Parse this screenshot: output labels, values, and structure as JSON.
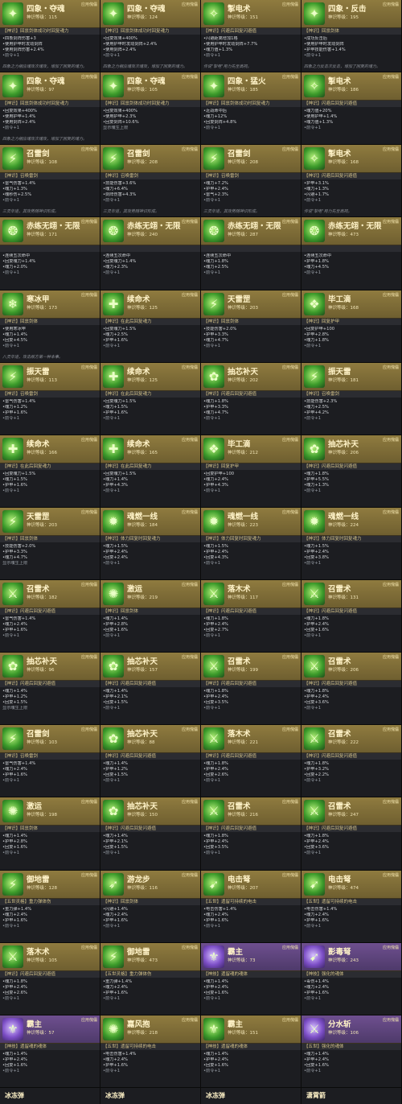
{
  "cards": [
    {
      "name": "四象・夺魂",
      "sub": "神识等级：115",
      "tag": "应用傀儡",
      "type": "【神识】回禀剑体成功时回复魂力",
      "lines": [
        "•四象剑阵伤害+3",
        "•使用护甲时发动剑阵",
        "•使用剑阵伤害+2.4%"
      ],
      "more": "•前令+1",
      "lore": "四象之力相应魂攻次魂攻，增加了回复的魂力。",
      "color": "gold",
      "icon": "✦"
    },
    {
      "name": "四象・夺魂",
      "sub": "神识等级：124",
      "tag": "应用傀儡",
      "type": "【神识】回禀剑体成功时回复魂力",
      "lines": [
        "•回复效果+400%",
        "•使用护甲时发动剑阵+2.4%",
        "•使用剑阵+2.4%"
      ],
      "more": "•前令+1",
      "lore": "四象之力相应魂攻次魂攻，增加了回复的魂力。",
      "color": "gold",
      "icon": "✦"
    },
    {
      "name": "掣电术",
      "sub": "神识等级：151",
      "tag": "应用傀儡",
      "type": "【神识】闪避后回复闪避值",
      "lines": [
        "•闪避距离增加1格",
        "•使用护甲时发动剑阵+7.7%",
        "•魂力值+1.3%"
      ],
      "more": "•前令+1",
      "lore": "传说\"掣电\"用力先至高视。",
      "color": "gold",
      "icon": "✧"
    },
    {
      "name": "四象・反击",
      "sub": "神识等级：195",
      "tag": "应用傀儡",
      "type": "【神识】回禀剑体",
      "lines": [
        "•成功反击后",
        "•使用护甲时发动剑阵",
        "•护甲技能伤害+1.4%"
      ],
      "more": "•前令+1",
      "lore": "四象之力反击次反击，增加了回复的魂力。",
      "color": "gold",
      "icon": "✦"
    },
    {
      "name": "四象・夺魂",
      "sub": "神识等级：97",
      "tag": "应用傀儡",
      "type": "【神识】回禀剑体成功时回复魂力",
      "lines": [
        "•回复效果+400%",
        "•使用护甲+1.4%",
        "•使用剑阵+2.4%"
      ],
      "more": "•前令+1",
      "lore": "四象之力相应魂攻次魂攻，增加了回复的魂力。",
      "color": "gold",
      "icon": "✦"
    },
    {
      "name": "四象・夺魂",
      "sub": "神识等级：105",
      "tag": "应用傀儡",
      "type": "【神识】回禀剑体成功时回复魂力",
      "lines": [
        "•回复效果+400%",
        "•使用护甲+2.3%",
        "•回复剑阵+10.6%"
      ],
      "more": "显示魂生上限",
      "lore": "",
      "color": "gold",
      "icon": "✦"
    },
    {
      "name": "四象・猛火",
      "sub": "神识等级：185",
      "tag": "应用傀儡",
      "type": "【神识】回禀剑体成功时回复魂力",
      "lines": [
        "•近战命中后",
        "•魂力+12%",
        "•回复剑阵+4.8%"
      ],
      "more": "•前令+1",
      "lore": "",
      "color": "gold",
      "icon": "✦"
    },
    {
      "name": "掣电术",
      "sub": "神识等级：186",
      "tag": "应用傀儡",
      "type": "【神识】闪避后回复闪避值",
      "lines": [
        "•魂力值+20%",
        "•使用护甲+1.4%",
        "•魂力值+1.3%"
      ],
      "more": "•前令+1",
      "lore": "",
      "color": "gold",
      "icon": "✧"
    },
    {
      "name": "召雷剑",
      "sub": "神识等级：108",
      "tag": "应用傀儡",
      "type": "【神识】召唤雷剑",
      "lines": [
        "•雷气伤害+1.4%",
        "•魂力+1.3%",
        "•魂秒伤+2.5%"
      ],
      "more": "•前令+1",
      "lore": "三灵华道，其攻势随神识形成。",
      "color": "gold",
      "icon": "⚡"
    },
    {
      "name": "召雷剑",
      "sub": "神识等级：208",
      "tag": "应用傀儡",
      "type": "【神识】召唤雷剑",
      "lines": [
        "•技能伤害+3.6%",
        "•魂力+6.4%",
        "•剑阵伤害+4.3%"
      ],
      "more": "•前令+1",
      "lore": "三灵华道，其攻势随神识形成。",
      "color": "gold",
      "icon": "⚡"
    },
    {
      "name": "召雷剑",
      "sub": "神识等级：208",
      "tag": "应用傀儡",
      "type": "【神识】召唤雷剑",
      "lines": [
        "•魂力+7.2%",
        "•护甲+2.4%",
        "•雷气+2.3%"
      ],
      "more": "•前令+1",
      "lore": "三灵华道，其攻势随神识形成。",
      "color": "gold",
      "icon": "⚡"
    },
    {
      "name": "掣电术",
      "sub": "神识等级：168",
      "tag": "应用傀儡",
      "type": "【神识】闪避后回复闪避值",
      "lines": [
        "•护甲+3.1%",
        "•魂力+1.3%",
        "•闪避+1.7%"
      ],
      "more": "•前令+1",
      "lore": "传说\"掣电\"用力先至高视。",
      "color": "gold",
      "icon": "✧"
    },
    {
      "name": "赤练无翊・无限",
      "sub": "神识等级：171",
      "tag": "应用傀儡",
      "type": "",
      "lines": [
        "•连续五次命中",
        "•回复魂力+1.4%",
        "•魂力+2.0%"
      ],
      "more": "•前令+1",
      "lore": "",
      "color": "gold",
      "icon": "❂"
    },
    {
      "name": "赤练无翊・无限",
      "sub": "神识等级：240",
      "tag": "应用傀儡",
      "type": "",
      "lines": [
        "•连续五次命中",
        "•回复魂力+1.4%",
        "•魂力+2.3%"
      ],
      "more": "•前令+1",
      "lore": "",
      "color": "gold",
      "icon": "❂"
    },
    {
      "name": "赤练无翊・无限",
      "sub": "神识等级：287",
      "tag": "应用傀儡",
      "type": "",
      "lines": [
        "•连续五次命中",
        "•魂力+1.8%",
        "•魂力+2.5%"
      ],
      "more": "•前令+1",
      "lore": "",
      "color": "gold",
      "icon": "❂"
    },
    {
      "name": "赤练无翊・无限",
      "sub": "神识等级：473",
      "tag": "应用傀儡",
      "type": "",
      "lines": [
        "•连续五次命中",
        "•护甲+1.8%",
        "•魂力+4.5%"
      ],
      "more": "•前令+1",
      "lore": "",
      "color": "gold",
      "icon": "❂"
    },
    {
      "name": "寒冰甲",
      "sub": "神识等级：173",
      "tag": "应用傀儡",
      "type": "【神识】回禀剑体",
      "lines": [
        "•使用寒冰甲",
        "•魂力+1.4%",
        "•回复+4.5%"
      ],
      "more": "•前令+1",
      "lore": "八灵华道，攻击敌方第一种本事。",
      "color": "gold",
      "icon": "❄"
    },
    {
      "name": "续命术",
      "sub": "神识等级：125",
      "tag": "应用傀儡",
      "type": "【神识】在此后回复魂力",
      "lines": [
        "•回复魂力+1.5%",
        "•魂力+2.5%",
        "•护甲+1.6%"
      ],
      "more": "•前令+1",
      "lore": "",
      "color": "gold",
      "icon": "✚"
    },
    {
      "name": "天雷罡",
      "sub": "神识等级：203",
      "tag": "应用傀儡",
      "type": "【神识】回禀剑体",
      "lines": [
        "•技能伤害+2.0%",
        "•护甲+3.3%",
        "•魂力+4.7%"
      ],
      "more": "•前令+1",
      "lore": "",
      "color": "gold",
      "icon": "⚡"
    },
    {
      "name": "毕工滴",
      "sub": "神识等级：168",
      "tag": "应用傀儡",
      "type": "【神识】回复护甲",
      "lines": [
        "•回复护甲+100",
        "•护甲+2.8%",
        "•魂力+1.8%"
      ],
      "more": "•前令+1",
      "lore": "",
      "color": "gold",
      "icon": "❖"
    },
    {
      "name": "振天雷",
      "sub": "神识等级：113",
      "tag": "应用傀儡",
      "type": "【神识】召唤雷剑",
      "lines": [
        "•雷气伤害+1.4%",
        "•魂力+1.2%",
        "•护甲+1.6%"
      ],
      "more": "•前令+1",
      "lore": "",
      "color": "gold",
      "icon": "⚡"
    },
    {
      "name": "续命术",
      "sub": "神识等级：125",
      "tag": "应用傀儡",
      "type": "【神识】在此后回复魂力",
      "lines": [
        "•回复魂力+1.5%",
        "•魂力+1.5%",
        "•护甲+1.6%"
      ],
      "more": "•前令+1",
      "lore": "",
      "color": "gold",
      "icon": "✚"
    },
    {
      "name": "抽芯补天",
      "sub": "神识等级：202",
      "tag": "应用傀儡",
      "type": "【神识】闪避后回复闪避值",
      "lines": [
        "•魂力+1.8%",
        "•护甲+3.3%",
        "•魂力+4.7%"
      ],
      "more": "•前令+1",
      "lore": "",
      "color": "gold",
      "icon": "✿"
    },
    {
      "name": "振天雷",
      "sub": "神识等级：181",
      "tag": "应用傀儡",
      "type": "【神识】召唤雷剑",
      "lines": [
        "•技能伤害+2.3%",
        "•魂力+2.5%",
        "•护甲+4.2%"
      ],
      "more": "•前令+1",
      "lore": "",
      "color": "gold",
      "icon": "⚡"
    },
    {
      "name": "续命术",
      "sub": "神识等级：166",
      "tag": "应用傀儡",
      "type": "【神识】在此后回复魂力",
      "lines": [
        "•回复魂力+1.5%",
        "•魂力+1.5%",
        "•护甲+1.6%"
      ],
      "more": "•前令+1",
      "lore": "",
      "color": "gold",
      "icon": "✚"
    },
    {
      "name": "续命术",
      "sub": "神识等级：165",
      "tag": "应用傀儡",
      "type": "【神识】在此后回复魂力",
      "lines": [
        "•回复魂力+1.5%",
        "•魂力+1.4%",
        "•护甲+4.3%"
      ],
      "more": "•前令+1",
      "lore": "",
      "color": "gold",
      "icon": "✚"
    },
    {
      "name": "毕工滴",
      "sub": "神识等级：212",
      "tag": "应用傀儡",
      "type": "【神识】回复护甲",
      "lines": [
        "•回复护甲+100",
        "•魂力+2.4%",
        "•护甲+4.3%"
      ],
      "more": "•前令+1",
      "lore": "",
      "color": "gold",
      "icon": "❖"
    },
    {
      "name": "抽芯补天",
      "sub": "神识等级：206",
      "tag": "应用傀儡",
      "type": "【神识】闪避后回复闪避值",
      "lines": [
        "•魂力+1.8%",
        "•护甲+5.5%",
        "•魂力+1.3%"
      ],
      "more": "•前令+1",
      "lore": "",
      "color": "gold",
      "icon": "✿"
    },
    {
      "name": "天雷罡",
      "sub": "神识等级：203",
      "tag": "应用傀儡",
      "type": "【神识】回禀剑体",
      "lines": [
        "•技能伤害+2.0%",
        "•护甲+3.3%",
        "•魂力+4.7%"
      ],
      "more": "显示魂生上限",
      "lore": "",
      "color": "gold",
      "icon": "⚡"
    },
    {
      "name": "魂燃一线",
      "sub": "神识等级：184",
      "tag": "应用傀儡",
      "type": "【神识】体力回复时回复魂力",
      "lines": [
        "•魂力+1.5%",
        "•护甲+2.4%",
        "•回复+2.4%"
      ],
      "more": "•前令+1",
      "lore": "",
      "color": "gold",
      "icon": "✹"
    },
    {
      "name": "魂燃一线",
      "sub": "神识等级：223",
      "tag": "应用傀儡",
      "type": "【神识】体力回复时回复魂力",
      "lines": [
        "•魂力+1.5%",
        "•护甲+2.4%",
        "•回复+4.3%"
      ],
      "more": "•前令+1",
      "lore": "",
      "color": "gold",
      "icon": "✹"
    },
    {
      "name": "魂燃一线",
      "sub": "神识等级：224",
      "tag": "应用傀儡",
      "type": "【神识】体力回复时回复魂力",
      "lines": [
        "•魂力+1.5%",
        "•护甲+2.4%",
        "•回复+3.8%"
      ],
      "more": "•前令+1",
      "lore": "",
      "color": "gold",
      "icon": "✹"
    },
    {
      "name": "召雷术",
      "sub": "神识等级：182",
      "tag": "应用傀儡",
      "type": "【神识】闪避后回复闪避值",
      "lines": [
        "•雷气伤害+1.4%",
        "•魂力+2.4%",
        "•护甲+1.6%"
      ],
      "more": "•前令+1",
      "lore": "",
      "color": "gold",
      "icon": "⚔"
    },
    {
      "name": "激运",
      "sub": "神识等级：219",
      "tag": "应用傀儡",
      "type": "【神识】回禀剑体",
      "lines": [
        "•魂力+1.4%",
        "•护甲+2.8%",
        "•回复+1.6%"
      ],
      "more": "•前令+1",
      "lore": "",
      "color": "gold",
      "icon": "✺"
    },
    {
      "name": "落木术",
      "sub": "神识等级：117",
      "tag": "应用傀儡",
      "type": "【神识】闪避后回复闪避值",
      "lines": [
        "•魂力+1.8%",
        "•护甲+2.4%",
        "•回复+2.7%"
      ],
      "more": "•前令+1",
      "lore": "",
      "color": "gold",
      "icon": "⚔"
    },
    {
      "name": "召雷术",
      "sub": "神识等级：131",
      "tag": "应用傀儡",
      "type": "【神识】闪避后回复闪避值",
      "lines": [
        "•魂力+1.8%",
        "•护甲+2.4%",
        "•回复+1.6%"
      ],
      "more": "•前令+1",
      "lore": "",
      "color": "gold",
      "icon": "⚔"
    },
    {
      "name": "抽芯补天",
      "sub": "神识等级：96",
      "tag": "应用傀儡",
      "type": "【神识】闪避后回复闪避值",
      "lines": [
        "•魂力+1.4%",
        "•护甲+1.2%",
        "•回复+1.5%"
      ],
      "more": "显示魂生上限",
      "lore": "",
      "color": "gold",
      "icon": "✿"
    },
    {
      "name": "抽芯补天",
      "sub": "神识等级：157",
      "tag": "应用傀儡",
      "type": "【神识】闪避后回复闪避值",
      "lines": [
        "•魂力+1.4%",
        "•护甲+2.1%",
        "•回复+1.5%"
      ],
      "more": "•前令+1",
      "lore": "",
      "color": "gold",
      "icon": "✿"
    },
    {
      "name": "召雷术",
      "sub": "神识等级：199",
      "tag": "应用傀儡",
      "type": "【神识】闪避后回复闪避值",
      "lines": [
        "•魂力+1.8%",
        "•护甲+2.4%",
        "•回复+3.5%"
      ],
      "more": "•前令+1",
      "lore": "",
      "color": "gold",
      "icon": "⚔"
    },
    {
      "name": "召雷术",
      "sub": "神识等级：206",
      "tag": "应用傀儡",
      "type": "【神识】闪避后回复闪避值",
      "lines": [
        "•魂力+1.8%",
        "•护甲+2.4%",
        "•回复+3.6%"
      ],
      "more": "•前令+1",
      "lore": "",
      "color": "gold",
      "icon": "⚔"
    },
    {
      "name": "召雷剑",
      "sub": "神识等级：103",
      "tag": "应用傀儡",
      "type": "【神识】召唤雷剑",
      "lines": [
        "•雷气伤害+1.4%",
        "•魂力+2.4%",
        "•护甲+1.6%"
      ],
      "more": "•前令+1",
      "lore": "",
      "color": "gold",
      "icon": "⚡"
    },
    {
      "name": "抽芯补天",
      "sub": "神识等级：88",
      "tag": "应用傀儡",
      "type": "【神识】闪避后回复闪避值",
      "lines": [
        "•魂力+1.4%",
        "•护甲+1.2%",
        "•回复+1.5%"
      ],
      "more": "•前令+1",
      "lore": "",
      "color": "gold",
      "icon": "✿"
    },
    {
      "name": "落木术",
      "sub": "神识等级：221",
      "tag": "应用傀儡",
      "type": "【神识】闪避后回复闪避值",
      "lines": [
        "•魂力+1.8%",
        "•护甲+2.4%",
        "•回复+2.6%"
      ],
      "more": "•前令+1",
      "lore": "",
      "color": "gold",
      "icon": "⚔"
    },
    {
      "name": "召雷术",
      "sub": "神识等级：222",
      "tag": "应用傀儡",
      "type": "【神识】闪避后回复闪避值",
      "lines": [
        "•魂力+1.8%",
        "•护甲+3.2%",
        "•回复+2.2%"
      ],
      "more": "•前令+1",
      "lore": "",
      "color": "gold",
      "icon": "⚔"
    },
    {
      "name": "激运",
      "sub": "神识等级：198",
      "tag": "应用傀儡",
      "type": "【神识】回禀剑体",
      "lines": [
        "•魂力+1.4%",
        "•护甲+2.8%",
        "•回复+1.6%"
      ],
      "more": "•前令+1",
      "lore": "",
      "color": "gold",
      "icon": "✺"
    },
    {
      "name": "抽芯补天",
      "sub": "神识等级：150",
      "tag": "应用傀儡",
      "type": "【神识】闪避后回复闪避值",
      "lines": [
        "•魂力+1.4%",
        "•护甲+2.1%",
        "•回复+1.5%"
      ],
      "more": "•前令+1",
      "lore": "",
      "color": "gold",
      "icon": "✿"
    },
    {
      "name": "召雷术",
      "sub": "神识等级：216",
      "tag": "应用傀儡",
      "type": "【神识】闪避后回复闪避值",
      "lines": [
        "•魂力+1.8%",
        "•护甲+2.4%",
        "•回复+3.5%"
      ],
      "more": "•前令+1",
      "lore": "",
      "color": "gold",
      "icon": "⚔"
    },
    {
      "name": "召雷术",
      "sub": "神识等级：247",
      "tag": "应用傀儡",
      "type": "【神识】闪避后回复闪避值",
      "lines": [
        "•魂力+1.8%",
        "•护甲+2.4%",
        "•回复+3.6%"
      ],
      "more": "•前令+1",
      "lore": "",
      "color": "gold",
      "icon": "⚔"
    },
    {
      "name": "御地雷",
      "sub": "神识等级：128",
      "tag": "应用傀儡",
      "type": "【五世灵格】重力弹体伤",
      "lines": [
        "•重力弹+1.4%",
        "•魂力+2.4%",
        "•护甲+1.6%"
      ],
      "more": "•前令+1",
      "lore": "",
      "color": "gold",
      "icon": "⚡"
    },
    {
      "name": "游龙步",
      "sub": "神识等级：116",
      "tag": "应用傀儡",
      "type": "【神识】回禀剑体",
      "lines": [
        "•闪避+1.4%",
        "•魂力+2.4%",
        "•护甲+1.6%"
      ],
      "more": "•前令+1",
      "lore": "",
      "color": "gold",
      "icon": "➶"
    },
    {
      "name": "电击弩",
      "sub": "神识等级：207",
      "tag": "应用傀儡",
      "type": "【五世】遗留可持续的电击",
      "lines": [
        "•电击伤害+1.4%",
        "•魂力+2.4%",
        "•护甲+1.6%"
      ],
      "more": "•前令+1",
      "lore": "",
      "color": "gold",
      "icon": "➹"
    },
    {
      "name": "电击弩",
      "sub": "神识等级：474",
      "tag": "应用傀儡",
      "type": "【五世】遗留可持续的电击",
      "lines": [
        "•电击伤害+1.4%",
        "•魂力+2.4%",
        "•护甲+1.6%"
      ],
      "more": "•前令+1",
      "lore": "",
      "color": "gold",
      "icon": "➹"
    },
    {
      "name": "落木术",
      "sub": "神识等级：105",
      "tag": "应用傀儡",
      "type": "【神识】闪避后回复闪避值",
      "lines": [
        "•魂力+1.8%",
        "•护甲+2.4%",
        "•回复+2.6%"
      ],
      "more": "•前令+1",
      "lore": "",
      "color": "gold",
      "icon": "⚔"
    },
    {
      "name": "御地雷",
      "sub": "神识等级：473",
      "tag": "应用傀儡",
      "type": "【五世灵格】重力弹体伤",
      "lines": [
        "•重力弹+1.4%",
        "•魂力+2.4%",
        "•护甲+1.6%"
      ],
      "more": "•前令+1",
      "lore": "",
      "color": "gold",
      "icon": "⚡"
    },
    {
      "name": "霸主",
      "sub": "神识等级：73",
      "tag": "应用傀儡",
      "type": "【神技】遗留魂的魂体",
      "lines": [
        "•魂力+1.4%",
        "•护甲+2.4%",
        "•回复+1.6%"
      ],
      "more": "•前令+1",
      "lore": "",
      "color": "purple",
      "icon": "⚜"
    },
    {
      "name": "影毒弩",
      "sub": "神识等级：243",
      "tag": "应用傀儡",
      "type": "【神技】强化的魂体",
      "lines": [
        "•毒伤+1.4%",
        "•魂力+2.4%",
        "•护甲+1.6%"
      ],
      "more": "•前令+1",
      "lore": "",
      "color": "purple",
      "icon": "➹"
    },
    {
      "name": "霸主",
      "sub": "神识等级：57",
      "tag": "应用傀儡",
      "type": "【神技】遗留魂的魂体",
      "lines": [
        "•魂力+1.4%",
        "•护甲+2.4%",
        "•回复+1.6%"
      ],
      "more": "•前令+1",
      "lore": "",
      "color": "purple",
      "icon": "⚜"
    },
    {
      "name": "嘉风抱",
      "sub": "神识等级：218",
      "tag": "应用傀儡",
      "type": "【五世】遗留可持续的电击",
      "lines": [
        "•电击伤害+1.4%",
        "•魂力+2.4%",
        "•护甲+1.6%"
      ],
      "more": "•前令+1",
      "lore": "",
      "color": "gold",
      "icon": "✺"
    },
    {
      "name": "霸主",
      "sub": "神识等级：151",
      "tag": "应用傀儡",
      "type": "【神技】遗留魂的魂体",
      "lines": [
        "•魂力+1.4%",
        "•护甲+2.4%",
        "•回复+1.6%"
      ],
      "more": "•前令+1",
      "lore": "",
      "color": "gold",
      "icon": "⚜"
    },
    {
      "name": "分水斩",
      "sub": "神识等级：106",
      "tag": "应用傀儡",
      "type": "【五世】强化的魂体",
      "lines": [
        "•魂力+1.4%",
        "•护甲+2.4%",
        "•回复+1.6%"
      ],
      "more": "•前令+1",
      "lore": "",
      "color": "purple",
      "icon": "⚔"
    }
  ],
  "footer": [
    "冰冻弹",
    "冰冻弹",
    "冰冻弹",
    "潇霄箭"
  ]
}
